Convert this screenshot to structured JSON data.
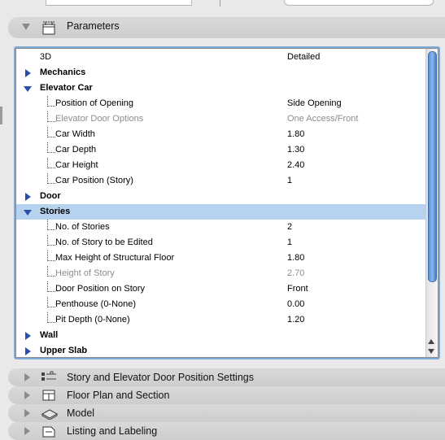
{
  "header": {
    "title": "Parameters"
  },
  "params": [
    {
      "label": "3D",
      "value": "Detailed",
      "type": "plain"
    },
    {
      "label": "Mechanics",
      "value": "",
      "type": "group",
      "state": "closed"
    },
    {
      "label": "Elevator Car",
      "value": "",
      "type": "group",
      "state": "open"
    },
    {
      "label": "Position of Opening",
      "value": "Side Opening",
      "type": "child"
    },
    {
      "label": "Elevator Door Options",
      "value": "One Access/Front",
      "type": "child",
      "dim": true
    },
    {
      "label": "Car  Width",
      "value": "1.80",
      "type": "child"
    },
    {
      "label": "Car Depth",
      "value": "1.30",
      "type": "child"
    },
    {
      "label": "Car Height",
      "value": "2.40",
      "type": "child"
    },
    {
      "label": "Car Position (Story)",
      "value": "1",
      "type": "child"
    },
    {
      "label": "Door",
      "value": "",
      "type": "group",
      "state": "closed"
    },
    {
      "label": "Stories",
      "value": "",
      "type": "group",
      "state": "open",
      "selected": true
    },
    {
      "label": "No. of Stories",
      "value": "2",
      "type": "child"
    },
    {
      "label": "No. of Story to be Edited",
      "value": "1",
      "type": "child"
    },
    {
      "label": "Max Height of Structural Floor",
      "value": "1.80",
      "type": "child"
    },
    {
      "label": "Height of Story",
      "value": "2.70",
      "type": "child",
      "dim": true
    },
    {
      "label": "Door Position on Story",
      "value": "Front",
      "type": "child"
    },
    {
      "label": "Penthouse (0-None)",
      "value": "0.00",
      "type": "child"
    },
    {
      "label": "Pit Depth (0-None)",
      "value": "1.20",
      "type": "child"
    },
    {
      "label": "Wall",
      "value": "",
      "type": "group",
      "state": "closed"
    },
    {
      "label": "Upper Slab",
      "value": "",
      "type": "group",
      "state": "closed"
    }
  ],
  "sections": [
    {
      "label": "Story and Elevator Door Position Settings",
      "icon": "story-settings-icon"
    },
    {
      "label": "Floor Plan and Section",
      "icon": "floor-plan-icon"
    },
    {
      "label": "Model",
      "icon": "model-icon"
    },
    {
      "label": "Listing and Labeling",
      "icon": "listing-icon"
    }
  ]
}
